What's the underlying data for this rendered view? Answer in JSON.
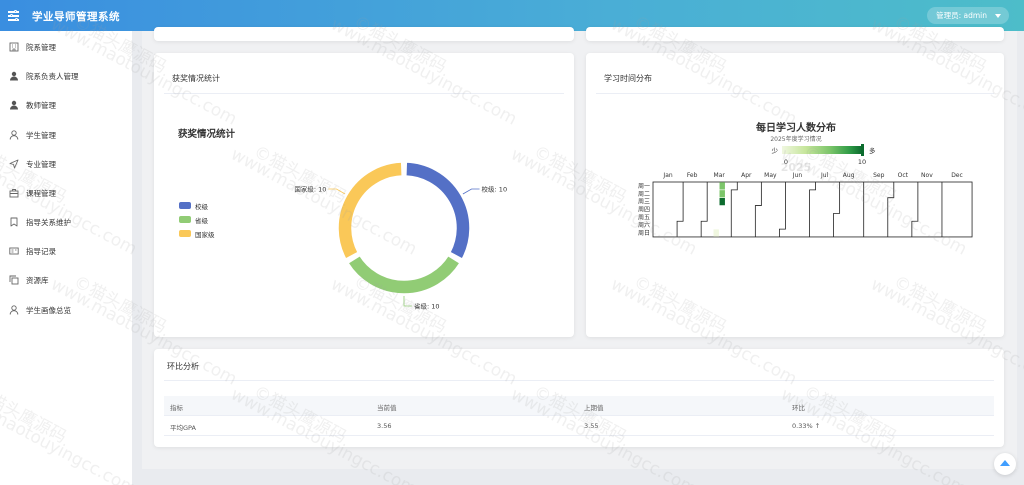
{
  "header": {
    "app_title": "学业导师管理系统",
    "user_label": "管理员: admin"
  },
  "sidebar": {
    "items": [
      {
        "label": "院系管理",
        "icon": "building-icon"
      },
      {
        "label": "院系负责人管理",
        "icon": "user-icon"
      },
      {
        "label": "教师管理",
        "icon": "user-icon"
      },
      {
        "label": "学生管理",
        "icon": "user-outline-icon"
      },
      {
        "label": "专业管理",
        "icon": "send-icon"
      },
      {
        "label": "课程管理",
        "icon": "briefcase-icon"
      },
      {
        "label": "指导关系维护",
        "icon": "bookmark-icon"
      },
      {
        "label": "指导记录",
        "icon": "id-card-icon"
      },
      {
        "label": "资源库",
        "icon": "copy-icon"
      },
      {
        "label": "学生画像总览",
        "icon": "user-outline-icon"
      }
    ]
  },
  "award_card": {
    "title": "获奖情况统计",
    "chart_data": {
      "type": "pie",
      "title": "获奖情况统计",
      "donut": true,
      "legend_position": "left",
      "categories": [
        "校级",
        "省级",
        "国家级"
      ],
      "values": [
        10,
        10,
        10
      ],
      "colors": [
        "#5470c6",
        "#91cc75",
        "#fac858"
      ],
      "slice_labels": [
        "校级: 10",
        "省级: 10",
        "国家级: 10"
      ]
    }
  },
  "study_card": {
    "title": "学习时间分布",
    "chart_data": {
      "type": "heatmap",
      "title": "每日学习人数分布",
      "subtitle": "2025年度学习情况",
      "year_watermark": "2025",
      "visual_map": {
        "min": 0,
        "max": 10,
        "low_label": "少",
        "high_label": "多",
        "colors": [
          "#f0f7e0",
          "#c5e59a",
          "#7cc56a",
          "#2e9a46",
          "#0c6b2e"
        ]
      },
      "months": [
        "Jan",
        "Feb",
        "Mar",
        "Apr",
        "May",
        "Jun",
        "Jul",
        "Aug",
        "Sep",
        "Oct",
        "Nov",
        "Dec"
      ],
      "weekdays": [
        "周一",
        "周二",
        "周三",
        "周四",
        "周五",
        "周六",
        "周日"
      ],
      "cells": [
        {
          "week": 11,
          "day": 0,
          "value": 4
        },
        {
          "week": 11,
          "day": 1,
          "value": 6
        },
        {
          "week": 11,
          "day": 2,
          "value": 10
        },
        {
          "week": 10,
          "day": 6,
          "value": 1
        }
      ]
    }
  },
  "mom_card": {
    "title": "环比分析",
    "columns": [
      "指标",
      "当前值",
      "上期值",
      "环比"
    ],
    "rows": [
      {
        "metric": "平均GPA",
        "current": "3.56",
        "previous": "3.55",
        "change": "0.33% ↑"
      }
    ]
  },
  "watermark": {
    "text_cn": "©猫头鹰源码",
    "text_en": "www.maotouyingcc.com"
  }
}
